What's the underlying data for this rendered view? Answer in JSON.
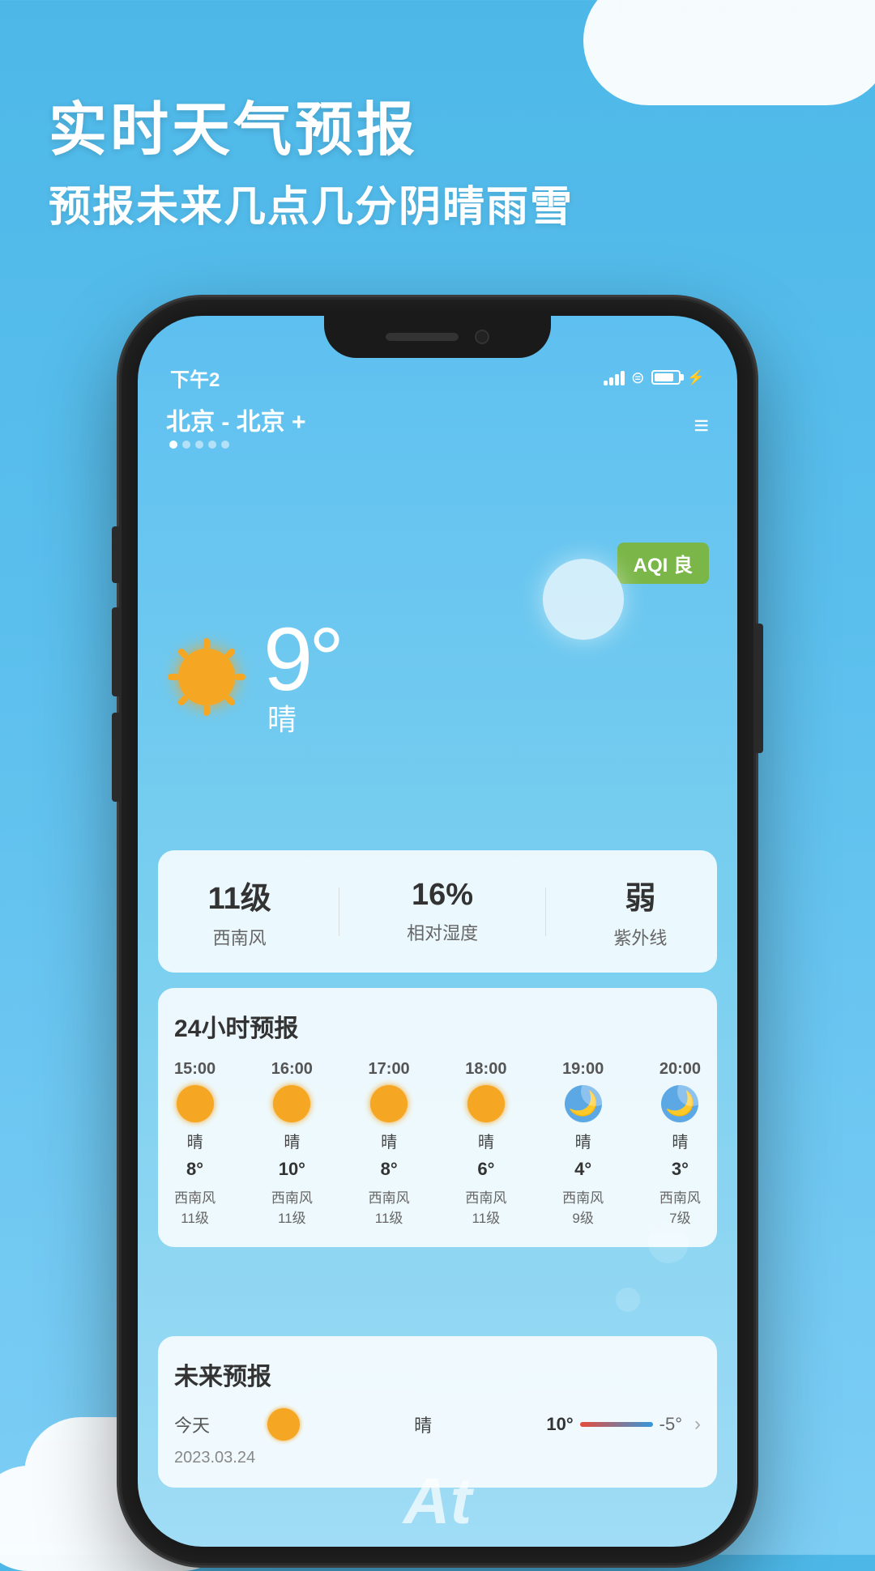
{
  "background_color": "#4db8e8",
  "promo": {
    "title": "实时天气预报",
    "subtitle": "预报未来几点几分阴晴雨雪"
  },
  "clouds": {
    "top_right": true,
    "bottom_left": true
  },
  "phone": {
    "status_bar": {
      "time": "下午2",
      "battery_percent": 85
    },
    "app": {
      "location": "北京 - 北京 +",
      "menu_icon": "≡",
      "aqi_label": "AQI 良",
      "current_weather": {
        "temperature": "9°",
        "description": "晴"
      },
      "stats": [
        {
          "value": "11级",
          "label": "西南风"
        },
        {
          "value": "16%",
          "label": "相对湿度"
        },
        {
          "value": "弱",
          "label": "紫外线"
        }
      ],
      "hourly_forecast": {
        "title": "24小时预报",
        "hours": [
          {
            "time": "15:00",
            "icon": "sun",
            "desc": "晴",
            "temp": "8°",
            "wind": "西南风",
            "level": "11级"
          },
          {
            "time": "16:00",
            "icon": "sun",
            "desc": "晴",
            "temp": "10°",
            "wind": "西南风",
            "level": "11级"
          },
          {
            "time": "17:00",
            "icon": "sun",
            "desc": "晴",
            "temp": "8°",
            "wind": "西南风",
            "level": "11级"
          },
          {
            "time": "18:00",
            "icon": "sun",
            "desc": "晴",
            "temp": "6°",
            "wind": "西南风",
            "level": "11级"
          },
          {
            "time": "19:00",
            "icon": "moon",
            "desc": "晴",
            "temp": "4°",
            "wind": "西南风",
            "level": "9级"
          },
          {
            "time": "20:00",
            "icon": "moon",
            "desc": "晴",
            "temp": "3°",
            "wind": "西南风",
            "level": "7级"
          }
        ]
      },
      "future_forecast": {
        "title": "未来预报",
        "rows": [
          {
            "date": "2023.03.24",
            "label": "今天",
            "icon": "sun",
            "desc": "晴",
            "temp_max": "10°",
            "temp_min": "-5°"
          }
        ]
      }
    }
  },
  "bottom_text": "At"
}
